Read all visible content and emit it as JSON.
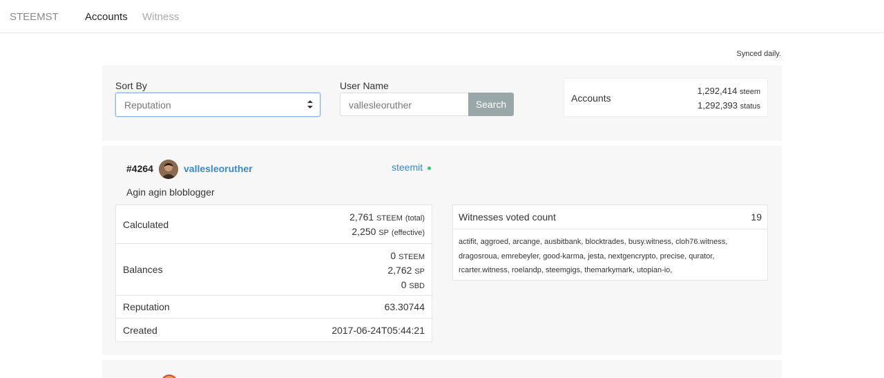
{
  "nav": {
    "brand": "STEEMST",
    "links": [
      {
        "label": "Accounts"
      },
      {
        "label": "Witness"
      }
    ]
  },
  "synced_note": "Synced daily.",
  "search": {
    "sort_label": "Sort By",
    "sort_value": "Reputation",
    "user_label": "User Name",
    "user_value": "vallesleoruther",
    "button_label": "Search"
  },
  "accounts_summary": {
    "title": "Accounts",
    "steem_count": "1,292,414",
    "steem_unit": "steem",
    "status_count": "1,292,393",
    "status_unit": "status"
  },
  "account": {
    "rank": "#4264",
    "username": "vallesleoruther",
    "app": "steemit",
    "status_color": "#2ecc71",
    "bio": "Agin agin bloblogger",
    "calculated": {
      "label": "Calculated",
      "total_value": "2,761",
      "total_unit": "STEEM",
      "total_note": "(total)",
      "effective_value": "2,250",
      "effective_unit": "SP",
      "effective_note": "(effective)"
    },
    "balances": {
      "label": "Balances",
      "steem_value": "0",
      "steem_unit": "STEEM",
      "sp_value": "2,762",
      "sp_unit": "SP",
      "sbd_value": "0",
      "sbd_unit": "SBD"
    },
    "reputation": {
      "label": "Reputation",
      "value": "63.30744"
    },
    "created": {
      "label": "Created",
      "value": "2017-06-24T05:44:21"
    },
    "witnesses": {
      "title": "Witnesses voted count",
      "count": "19",
      "list_line1": "actifit, aggroed, arcange, ausbitbank, blocktrades, busy.witness, cloh76.witness,",
      "list_line2": "dragosroua, emrebeyler, good-karma, jesta, nextgencrypto, precise, qurator,",
      "list_line3": "rcarter.witness, roelandp, steemgigs, themarkymark, utopian-io,"
    }
  },
  "colors": {
    "link_blue": "#3a88c5",
    "button_gray": "#9aa7a8",
    "panel_bg": "#f7f7f7"
  }
}
